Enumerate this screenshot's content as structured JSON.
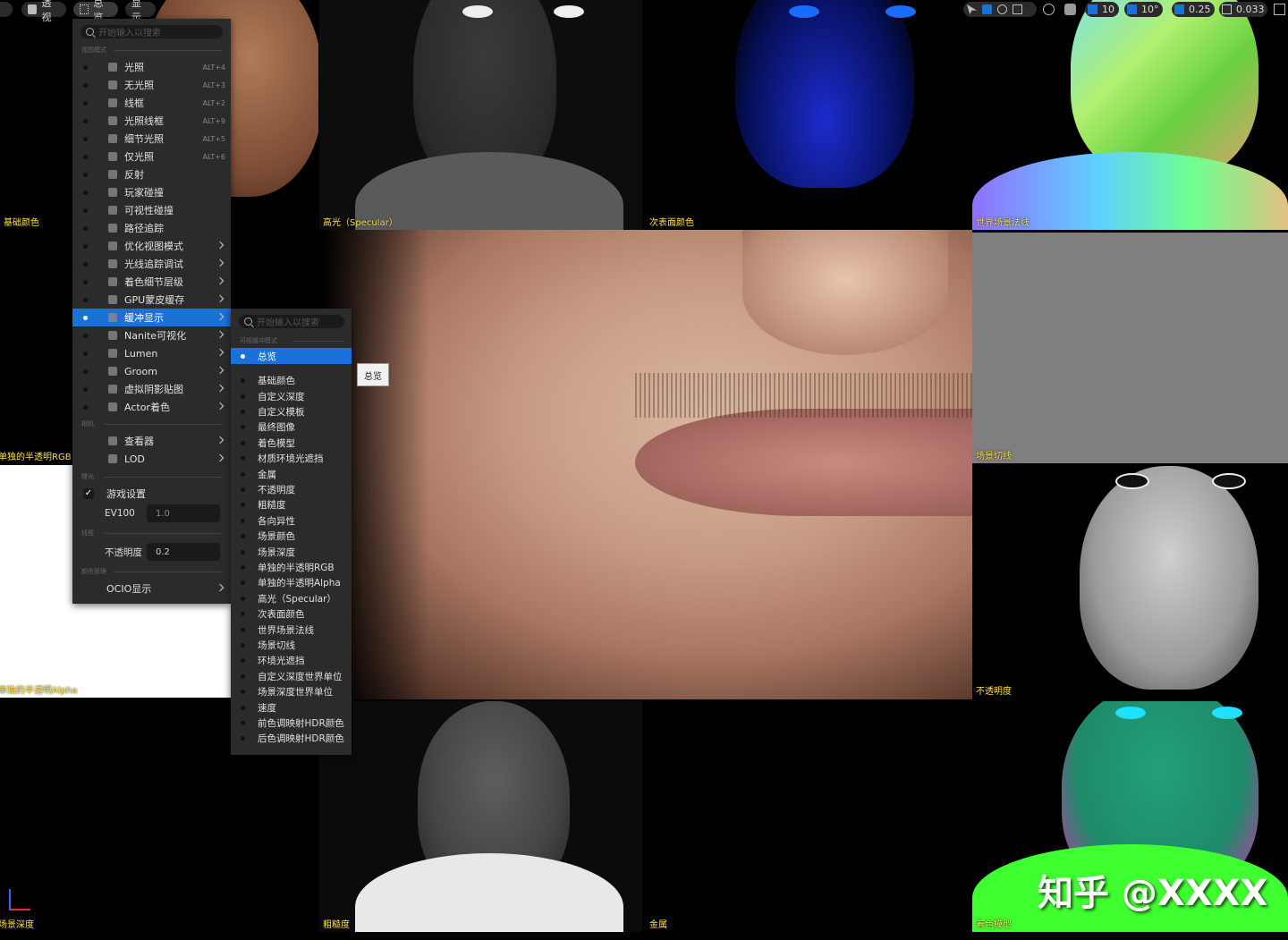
{
  "toolbar": {
    "perspective": "透视",
    "overview": "总览",
    "show": "显示",
    "grid": "10",
    "angle": "10°",
    "scale": "0.25",
    "camera": "0.033"
  },
  "tiles": {
    "base_color": "基础颜色",
    "specular": "高光（Specular）",
    "subsurface": "次表面颜色",
    "world_normal": "世界场景法线",
    "separate_rgb": "单独的半透明RGB",
    "scene_cut": "场景切线",
    "separate_alpha": "单独的半透明Alpha",
    "opacity": "不透明度",
    "scene_depth": "场景深度",
    "roughness": "粗糙度",
    "metallic": "金属",
    "shading_model": "着色模型"
  },
  "main_menu": {
    "search_placeholder": "开始输入以搜索",
    "section_view_mode": "视图模式",
    "items": [
      {
        "label": "光照",
        "shortcut": "ALT+4"
      },
      {
        "label": "无光照",
        "shortcut": "ALT+3"
      },
      {
        "label": "线框",
        "shortcut": "ALT+2"
      },
      {
        "label": "光照线框",
        "shortcut": "ALT+9"
      },
      {
        "label": "细节光照",
        "shortcut": "ALT+5"
      },
      {
        "label": "仅光照",
        "shortcut": "ALT+6"
      },
      {
        "label": "反射",
        "shortcut": ""
      },
      {
        "label": "玩家碰撞",
        "shortcut": ""
      },
      {
        "label": "可视性碰撞",
        "shortcut": ""
      },
      {
        "label": "路径追踪",
        "shortcut": ""
      },
      {
        "label": "优化视图模式",
        "shortcut": ""
      },
      {
        "label": "光线追踪调试",
        "shortcut": ""
      },
      {
        "label": "着色细节层级",
        "shortcut": ""
      },
      {
        "label": "GPU蒙皮缓存",
        "shortcut": ""
      },
      {
        "label": "缓冲显示",
        "shortcut": ""
      },
      {
        "label": "Nanite可视化",
        "shortcut": ""
      },
      {
        "label": "Lumen",
        "shortcut": ""
      },
      {
        "label": "Groom",
        "shortcut": ""
      },
      {
        "label": "虚拟阴影贴图",
        "shortcut": ""
      },
      {
        "label": "Actor着色",
        "shortcut": ""
      }
    ],
    "section_camera": "相机",
    "viewer": "查看器",
    "lod": "LOD",
    "section_exposure": "曝光",
    "game_settings": "游戏设置",
    "ev100_label": "EV100",
    "ev100_value": "1.0",
    "section_wireframe": "线框",
    "opacity_label": "不透明度",
    "opacity_value": "0.2",
    "section_color": "颜色管理",
    "ocio": "OCIO显示"
  },
  "sub_menu": {
    "search_placeholder": "开始输入以搜索",
    "section": "可视缓冲模式",
    "selected": "总览",
    "items": [
      "基础颜色",
      "自定义深度",
      "自定义模板",
      "最终图像",
      "着色模型",
      "材质环境光遮挡",
      "金属",
      "不透明度",
      "粗糙度",
      "各向异性",
      "场景颜色",
      "场景深度",
      "单独的半透明RGB",
      "单独的半透明Alpha",
      "高光（Specular）",
      "次表面颜色",
      "世界场景法线",
      "场景切线",
      "环境光遮挡",
      "自定义深度世界单位",
      "场景深度世界单位",
      "速度",
      "前色调映射HDR颜色",
      "后色调映射HDR颜色"
    ]
  },
  "tooltip": "总览",
  "watermark": "知乎 @XXXX"
}
